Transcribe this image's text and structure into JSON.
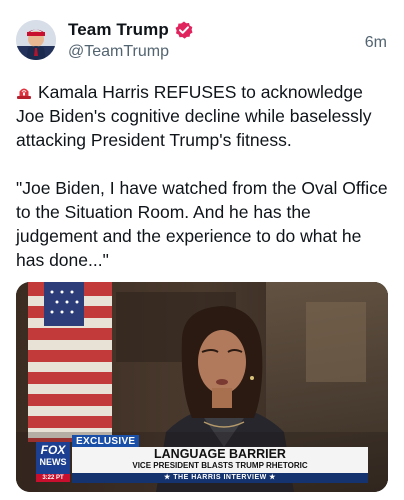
{
  "post": {
    "author": {
      "display_name": "Team Trump",
      "handle": "@TeamTrump",
      "verified": true,
      "verified_color": "#e0245e"
    },
    "timestamp": "6m",
    "paragraphs": [
      "Kamala Harris REFUSES to acknowledge Joe Biden's cognitive decline while baselessly attacking President Trump's fitness.",
      "\"Joe Biden, I have watched from the Oval Office to the Situation Room. And he has the judgement and the experience to do what he has done...\""
    ],
    "lead_icon": "siren-icon",
    "media": {
      "type": "video-still",
      "logo_top": "FOX",
      "logo_bottom": "NEWS",
      "time": "3:22 PT",
      "exclusive_tag": "EXCLUSIVE",
      "headline": "LANGUAGE BARRIER",
      "subheadline": "VICE PRESIDENT BLASTS TRUMP RHETORIC",
      "strip": "★ THE HARRIS INTERVIEW ★"
    }
  }
}
